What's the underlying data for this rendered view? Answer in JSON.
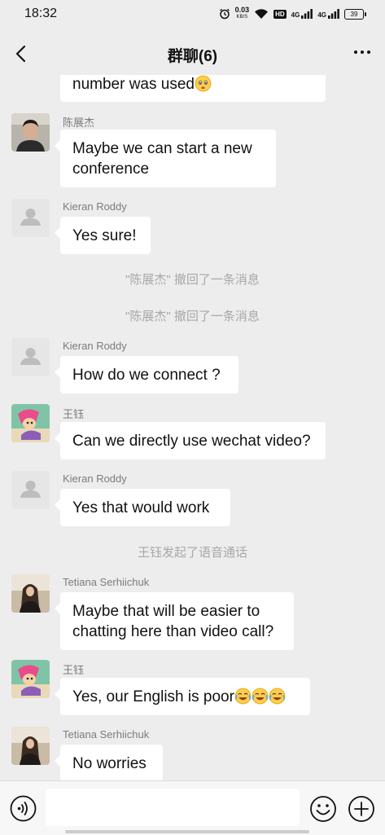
{
  "status_bar": {
    "time": "18:32",
    "speed_value": "0.03",
    "speed_unit": "KB/S",
    "hd": "HD",
    "net1": "4G",
    "net2": "4G",
    "battery": "39"
  },
  "header": {
    "title": "群聊(6)"
  },
  "messages": [
    {
      "text": "number was used"
    },
    {
      "sender": "陈展杰",
      "text": "Maybe we can start a new conference"
    },
    {
      "sender": "Kieran Roddy",
      "text": "Yes sure!"
    },
    {
      "sender": "Kieran Roddy",
      "text": "How do we connect ?"
    },
    {
      "sender": "王钰",
      "text": "Can we directly use wechat video?"
    },
    {
      "sender": "Kieran Roddy",
      "text": "Yes that would work"
    },
    {
      "sender": "Tetiana Serhiichuk",
      "text": "Maybe that will be easier to chatting here than video call?"
    },
    {
      "sender": "王钰",
      "text": "Yes, our English is poor"
    },
    {
      "sender": "Tetiana Serhiichuk",
      "text": "No worries"
    }
  ],
  "system_notices": [
    "\"陈展杰\" 撤回了一条消息",
    "\"陈展杰\" 撤回了一条消息",
    "王钰发起了语音通话"
  ],
  "input": {
    "value": "",
    "placeholder": ""
  },
  "colors": {
    "background": "#ededed",
    "bubble": "#ffffff",
    "sender_name": "#7c7c7c",
    "system_text": "#a8a8a8"
  },
  "icons": [
    "back-arrow-icon",
    "more-icon",
    "voice-icon",
    "emoji-icon",
    "plus-icon",
    "wifi-icon",
    "alarm-icon",
    "signal-icon",
    "battery-icon"
  ]
}
